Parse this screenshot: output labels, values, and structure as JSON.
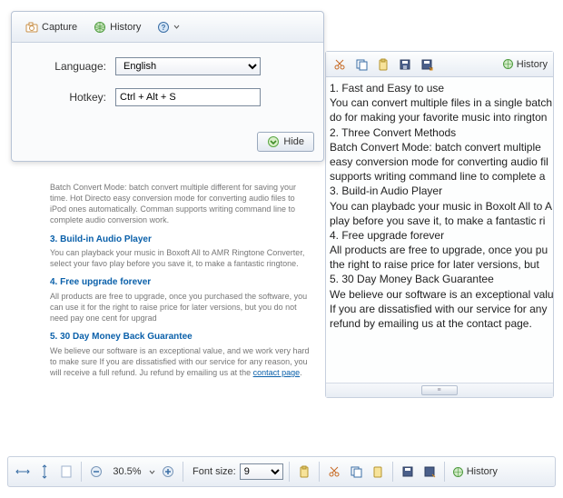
{
  "popup": {
    "capture_label": "Capture",
    "history_label": "History",
    "language_label": "Language:",
    "language_value": "English",
    "hotkey_label": "Hotkey:",
    "hotkey_value": "Ctrl + Alt + S",
    "hide_label": "Hide"
  },
  "bg_doc": {
    "intro": "Batch Convert Mode: batch convert multiple different for saving your time. Hot Directo easy conversion mode for converting audio files to iPod ones automatically. Comman supports writing command line to complete audio conversion work.",
    "s3_title": "3. Build-in Audio Player",
    "s3_body": "You can playback your music in Boxoft All to AMR Ringtone Converter, select your favo play before you save it, to make a fantastic ringtone.",
    "s4_title": "4. Free upgrade forever",
    "s4_body": "All products are free to upgrade, once you purchased the software, you can use it for the right to raise price for later versions, but you do not need pay one cent for upgrad",
    "s5_title": "5. 30 Day Money Back Guarantee",
    "s5_body": "We believe our software is an exceptional value, and we work very hard to make sure If you are dissatisfied with our service for any reason, you will receive a full refund. Ju refund by emailing us at the ",
    "contact_link": "contact page"
  },
  "right_panel": {
    "history_label": "History",
    "lines": [
      "1. Fast and Easy to use",
      "You can convert multiple files in a single batch",
      "do for making your favorite music into rington",
      "2. Three Convert Methods",
      "Batch Convert Mode: batch convert multiple",
      "easy conversion mode for converting audio fil",
      "supports writing command line to complete a",
      "3. Build-in Audio Player",
      "You can playbadc your music in Boxolt All to A",
      "play before you save it, to make a fantastic ri",
      "4. Free upgrade forever",
      "All products are free to upgrade, once you pu",
      "the right to raise price for later versions, but",
      "5. 30 Day Money Back Guarantee",
      "We believe our software is an exceptional valu",
      "If you are dissatisfied with our service for any",
      "refund by emailing us at the contact page."
    ]
  },
  "bottom_bar": {
    "zoom_value": "30.5%",
    "fontsize_label": "Font size:",
    "fontsize_value": "9",
    "history_label": "History"
  },
  "icons": {
    "capture": "camera-icon",
    "history": "globe-icon",
    "help": "help-icon",
    "hide": "down-arrow-icon"
  },
  "colors": {
    "link": "#0a60aa",
    "border": "#c7d0de"
  }
}
